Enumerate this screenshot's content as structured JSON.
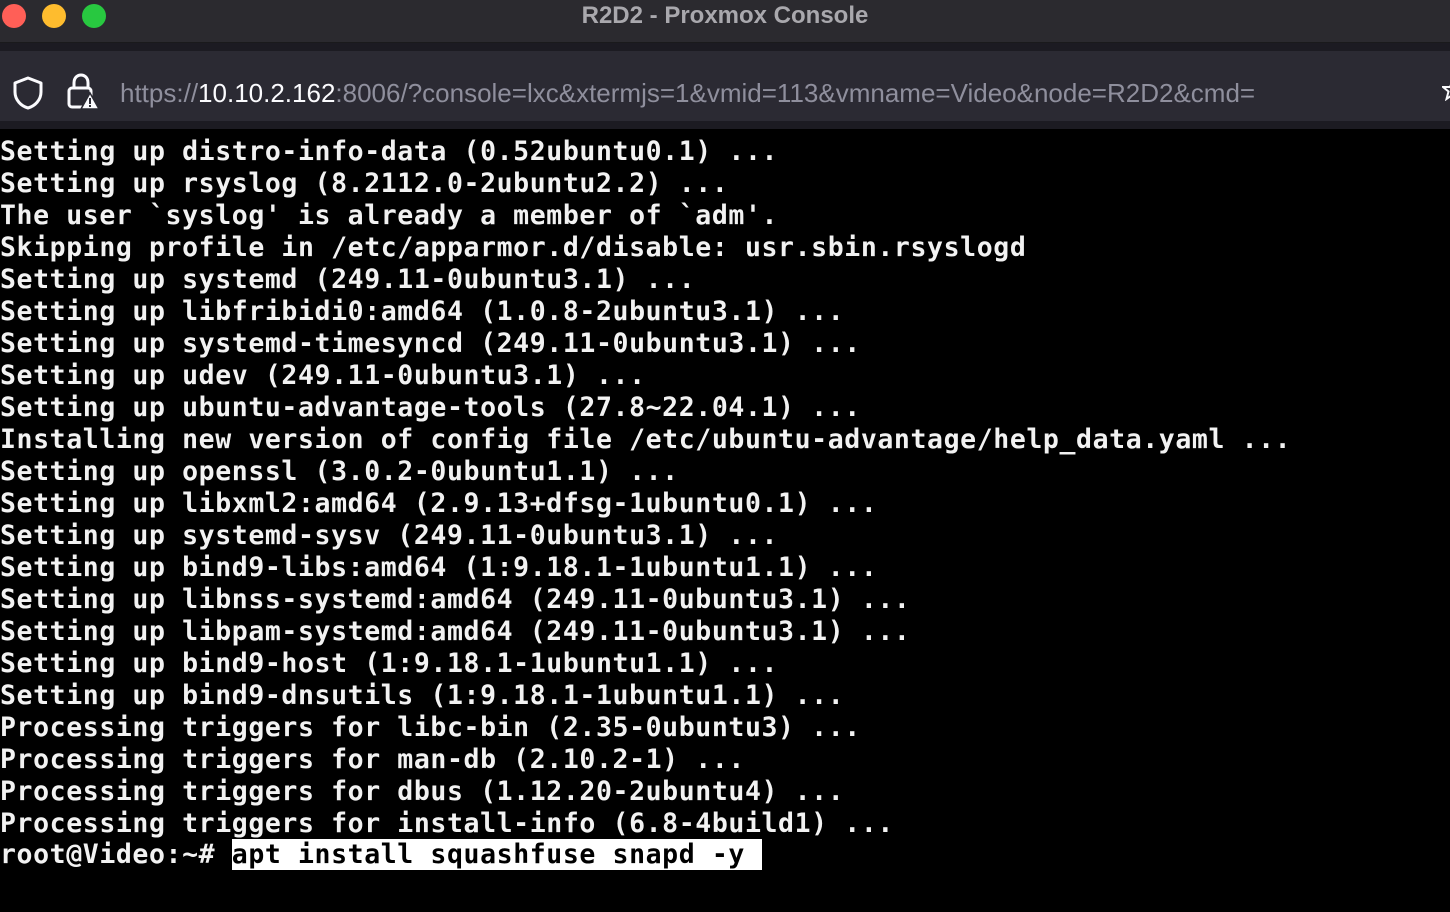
{
  "window": {
    "title": "R2D2 - Proxmox Console"
  },
  "urlbar": {
    "url_scheme": "https://",
    "url_host": "10.10.2.162",
    "url_rest": ":8006/?console=lxc&xtermjs=1&vmid=113&vmname=Video&node=R2D2&cmd="
  },
  "icons": {
    "shield": "shield-icon",
    "lock": "lock-warning-icon",
    "star": "bookmark-star-icon"
  },
  "colors": {
    "close": "#ff5f57",
    "minimize": "#febc2e",
    "maximize": "#28c840",
    "terminal_bg": "#000000",
    "terminal_fg": "#f2f2f2"
  },
  "terminal": {
    "lines": [
      "Setting up distro-info-data (0.52ubuntu0.1) ...",
      "Setting up rsyslog (8.2112.0-2ubuntu2.2) ...",
      "The user `syslog' is already a member of `adm'.",
      "Skipping profile in /etc/apparmor.d/disable: usr.sbin.rsyslogd",
      "Setting up systemd (249.11-0ubuntu3.1) ...",
      "Setting up libfribidi0:amd64 (1.0.8-2ubuntu3.1) ...",
      "Setting up systemd-timesyncd (249.11-0ubuntu3.1) ...",
      "Setting up udev (249.11-0ubuntu3.1) ...",
      "Setting up ubuntu-advantage-tools (27.8~22.04.1) ...",
      "Installing new version of config file /etc/ubuntu-advantage/help_data.yaml ...",
      "Setting up openssl (3.0.2-0ubuntu1.1) ...",
      "Setting up libxml2:amd64 (2.9.13+dfsg-1ubuntu0.1) ...",
      "Setting up systemd-sysv (249.11-0ubuntu3.1) ...",
      "Setting up bind9-libs:amd64 (1:9.18.1-1ubuntu1.1) ...",
      "Setting up libnss-systemd:amd64 (249.11-0ubuntu3.1) ...",
      "Setting up libpam-systemd:amd64 (249.11-0ubuntu3.1) ...",
      "Setting up bind9-host (1:9.18.1-1ubuntu1.1) ...",
      "Setting up bind9-dnsutils (1:9.18.1-1ubuntu1.1) ...",
      "Processing triggers for libc-bin (2.35-0ubuntu3) ...",
      "Processing triggers for man-db (2.10.2-1) ...",
      "Processing triggers for dbus (1.12.20-2ubuntu4) ...",
      "Processing triggers for install-info (6.8-4build1) ..."
    ],
    "prompt": "root@Video:~# ",
    "command": "apt install squashfuse snapd -y "
  }
}
